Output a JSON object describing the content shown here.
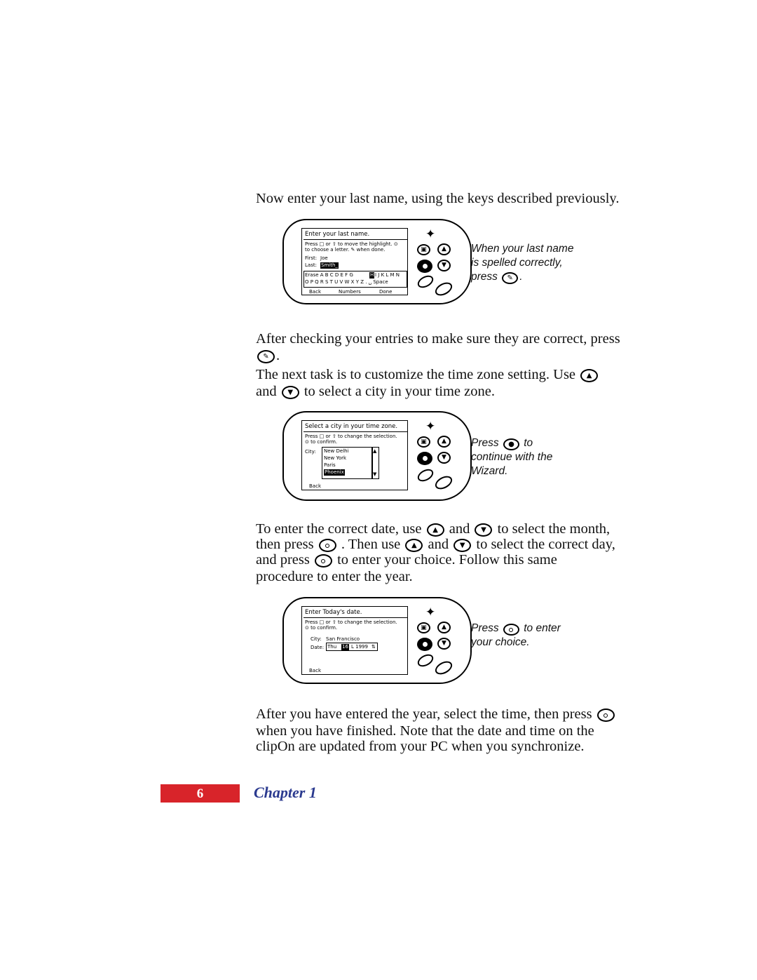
{
  "page": {
    "footer_page_number": "6",
    "footer_chapter": "Chapter  1",
    "accent_red": "#d8242a",
    "accent_blue": "#2b3a8f"
  },
  "paragraphs": {
    "p1": "Now enter your last name, using the keys described previously.",
    "p2a": "After checking your entries to make sure they are correct, press",
    "p2b": ".",
    "p3a": "The next task is to customize the time zone setting. Use",
    "p3b": "and",
    "p3c": "to select a city in your time zone.",
    "p4a": "To enter the correct date, use",
    "p4b": "and",
    "p4c": "to select the month,",
    "p4d": "then press",
    "p4e": ". Then use",
    "p4f": "and",
    "p4g": "to select the correct day,",
    "p4h": "and press",
    "p4i": "to enter your choice. Follow this same",
    "p4j": "procedure to enter the year.",
    "p5a": "After you have entered the year, select the time, then press",
    "p5b": "when you have finished. Note that the date and time on the",
    "p5c": "clipOn are updated from your PC when you synchronize."
  },
  "callouts": {
    "c1_line1": "When your last name",
    "c1_line2": "is spelled correctly,",
    "c1_line3": "press",
    "c1_line3b": ".",
    "c2_line1a": "Press",
    "c2_line1b": "to",
    "c2_line2": "continue with the",
    "c2_line3": "Wizard.",
    "c3_line1a": "Press",
    "c3_line1b": "to enter",
    "c3_line2": "your choice."
  },
  "devices": [
    {
      "id": "device-last-name",
      "screen": {
        "title": "Enter your last name.",
        "instr_line1": "Press □ or ⇧ to move the highlight. ⊙",
        "instr_line2": "to choose a letter. ✎ when done.",
        "field1_label": "First:",
        "field1_value": "Joe",
        "field2_label": "Last:",
        "field2_value": "Smith_",
        "keyboard_row1": "Erase  A  B  C  D  E  F  G",
        "keyboard_row1_sel": "H",
        "keyboard_row1b": "I  J  K  L  M  N",
        "keyboard_row2": "O  P  Q  R  S  T  U  V  W  X  Y  Z  .  ␣  Space",
        "softkey_back": "Back",
        "softkey_numbers": "Numbers",
        "softkey_done": "Done"
      }
    },
    {
      "id": "device-time-zone",
      "screen": {
        "title": "Select a city in your time zone.",
        "instr_line1": "Press □ or ⇧ to change the selection.",
        "instr_line2": "⊙ to confirm.",
        "field_label": "City:",
        "field_value": "New Delhi",
        "list_items": [
          "New York",
          "Paris",
          "Phoenix"
        ],
        "list_selected": "Phoenix",
        "softkey_back": "Back"
      }
    },
    {
      "id": "device-date",
      "screen": {
        "title": "Enter Today's date.",
        "instr_line1": "Press □ or ⇧ to change the selection.",
        "instr_line2": "⊙ to confirm.",
        "field1_label": "City:",
        "field1_value": "San Francisco",
        "field2_label": "Date:",
        "field2_value_a": "Thu",
        "field2_value_sel": "16",
        "field2_value_b": "L 1999",
        "softkey_back": "Back"
      }
    }
  ],
  "icons": {
    "key_select": "select-key",
    "key_up": "scroll-up-key",
    "key_down": "scroll-down-key",
    "key_pencil": "pencil-key",
    "key_star": "star-key",
    "key_menu": "menu-key",
    "key_confirm": "confirm-key"
  }
}
